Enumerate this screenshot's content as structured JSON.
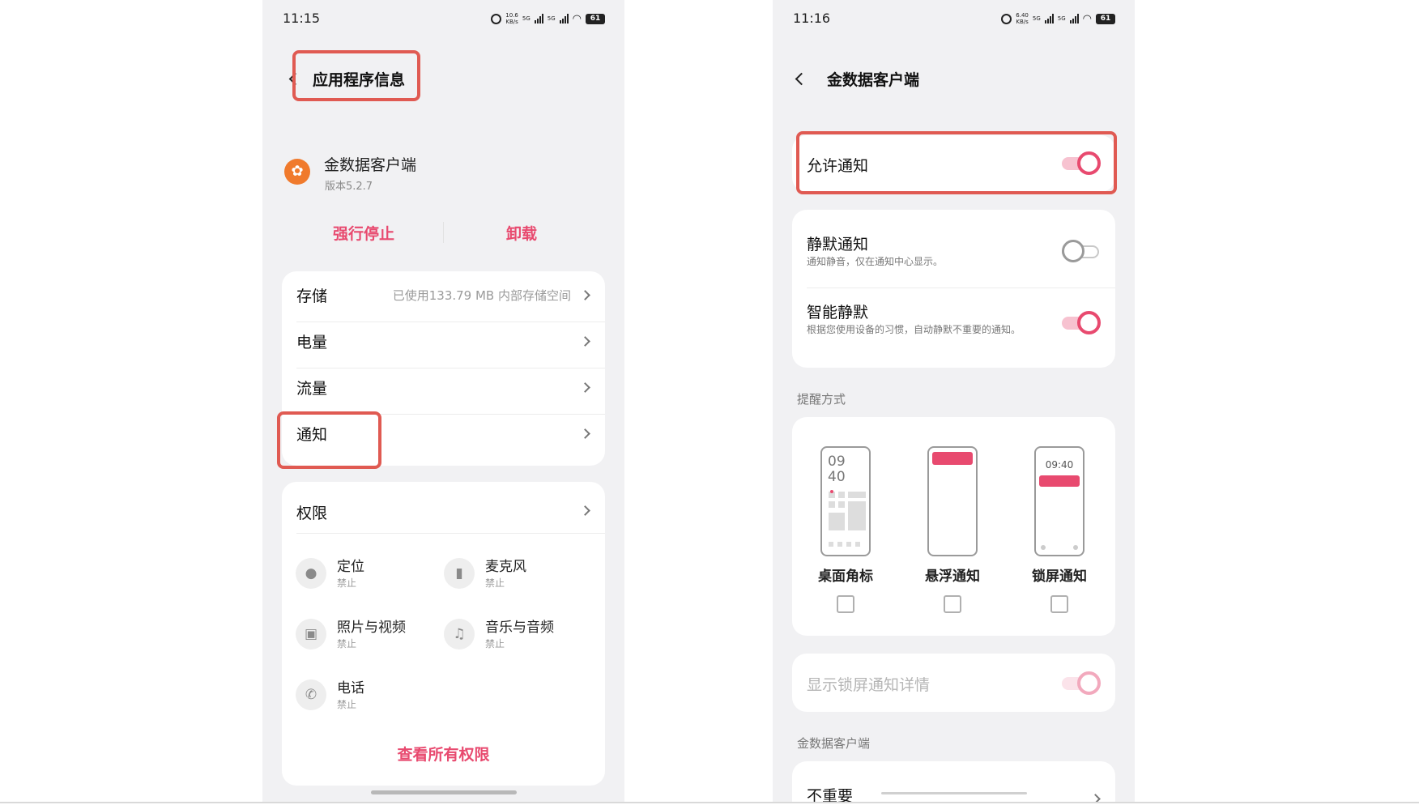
{
  "left": {
    "status": {
      "time": "11:15",
      "speed": "10.6",
      "speed_unit": "KB/s",
      "net_a": "5G",
      "net_b": "5G",
      "battery": "61"
    },
    "title": "应用程序信息",
    "app": {
      "name": "金数据客户端",
      "version": "版本5.2.7"
    },
    "actions": {
      "force_stop": "强行停止",
      "uninstall": "卸载"
    },
    "rows": [
      {
        "label": "存储",
        "value": "已使用133.79 MB 内部存储空间"
      },
      {
        "label": "电量",
        "value": ""
      },
      {
        "label": "流量",
        "value": ""
      },
      {
        "label": "通知",
        "value": ""
      }
    ],
    "permissions": {
      "label": "权限",
      "items": [
        {
          "name": "定位",
          "status": "禁止",
          "icon": "location-icon"
        },
        {
          "name": "麦克风",
          "status": "禁止",
          "icon": "microphone-icon"
        },
        {
          "name": "照片与视频",
          "status": "禁止",
          "icon": "image-icon"
        },
        {
          "name": "音乐与音频",
          "status": "禁止",
          "icon": "music-icon"
        },
        {
          "name": "电话",
          "status": "禁止",
          "icon": "phone-icon"
        }
      ],
      "view_all": "查看所有权限"
    }
  },
  "right": {
    "status": {
      "time": "11:16",
      "speed": "6.40",
      "speed_unit": "KB/s",
      "net_a": "5G",
      "net_b": "5G",
      "battery": "61"
    },
    "title": "金数据客户端",
    "allow_notifications": {
      "label": "允许通知",
      "on": true
    },
    "silent": {
      "label": "静默通知",
      "desc": "通知静音，仅在通知中心显示。",
      "on": false
    },
    "smart_silent": {
      "label": "智能静默",
      "desc": "根据您使用设备的习惯，自动静默不重要的通知。",
      "on": true
    },
    "reminder": {
      "section": "提醒方式",
      "clock_big": "09\n40",
      "clock_small": "09:40",
      "options": [
        {
          "label": "桌面角标",
          "checked": false
        },
        {
          "label": "悬浮通知",
          "checked": false
        },
        {
          "label": "锁屏通知",
          "checked": false
        }
      ]
    },
    "lockscreen_details": {
      "label": "显示锁屏通知详情",
      "on": true,
      "disabled": true
    },
    "channel_section": "金数据客户端",
    "channel": {
      "label": "不重要"
    }
  },
  "colors": {
    "accent": "#e84a6f",
    "highlight": "#e05a52",
    "background": "#f1f1f3"
  }
}
